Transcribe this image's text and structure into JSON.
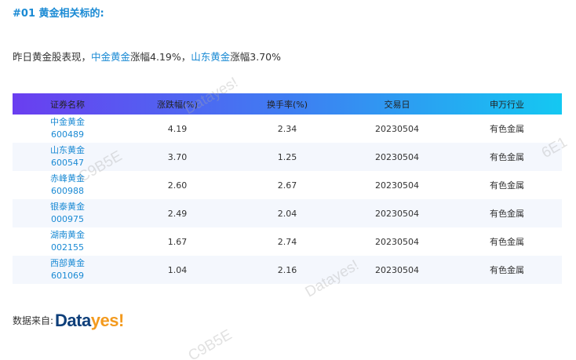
{
  "section": {
    "title": "#01 黄金相关标的:"
  },
  "summary": {
    "prefix": "昨日黄金股表现，",
    "stock1": "中金黄金",
    "mid1": "涨幅4.19%，",
    "stock2": "山东黄金",
    "mid2": "涨幅3.70%"
  },
  "table": {
    "headers": [
      "证券名称",
      "涨跌幅(%)",
      "换手率(%)",
      "交易日",
      "申万行业"
    ],
    "rows": [
      {
        "name": "中金黄金",
        "code": "600489",
        "change": "4.19",
        "turnover": "2.34",
        "date": "20230504",
        "industry": "有色金属"
      },
      {
        "name": "山东黄金",
        "code": "600547",
        "change": "3.70",
        "turnover": "1.25",
        "date": "20230504",
        "industry": "有色金属"
      },
      {
        "name": "赤峰黄金",
        "code": "600988",
        "change": "2.60",
        "turnover": "2.67",
        "date": "20230504",
        "industry": "有色金属"
      },
      {
        "name": "银泰黄金",
        "code": "000975",
        "change": "2.49",
        "turnover": "2.04",
        "date": "20230504",
        "industry": "有色金属"
      },
      {
        "name": "湖南黄金",
        "code": "002155",
        "change": "1.67",
        "turnover": "2.74",
        "date": "20230504",
        "industry": "有色金属"
      },
      {
        "name": "西部黄金",
        "code": "601069",
        "change": "1.04",
        "turnover": "2.16",
        "date": "20230504",
        "industry": "有色金属"
      }
    ]
  },
  "source": {
    "label": "数据来自:",
    "logo_part1": "Data",
    "logo_part2": "yes!"
  },
  "watermarks": [
    "Datayes!",
    "C9B5E",
    "6E1",
    "Datayes!",
    "C9B5E"
  ],
  "colors": {
    "accent": "#1a8ad4",
    "header_gradient_start": "#6a3ef0",
    "header_gradient_end": "#14c8f2",
    "logo_dark": "#0e3f7a",
    "logo_orange": "#f39a1e"
  }
}
